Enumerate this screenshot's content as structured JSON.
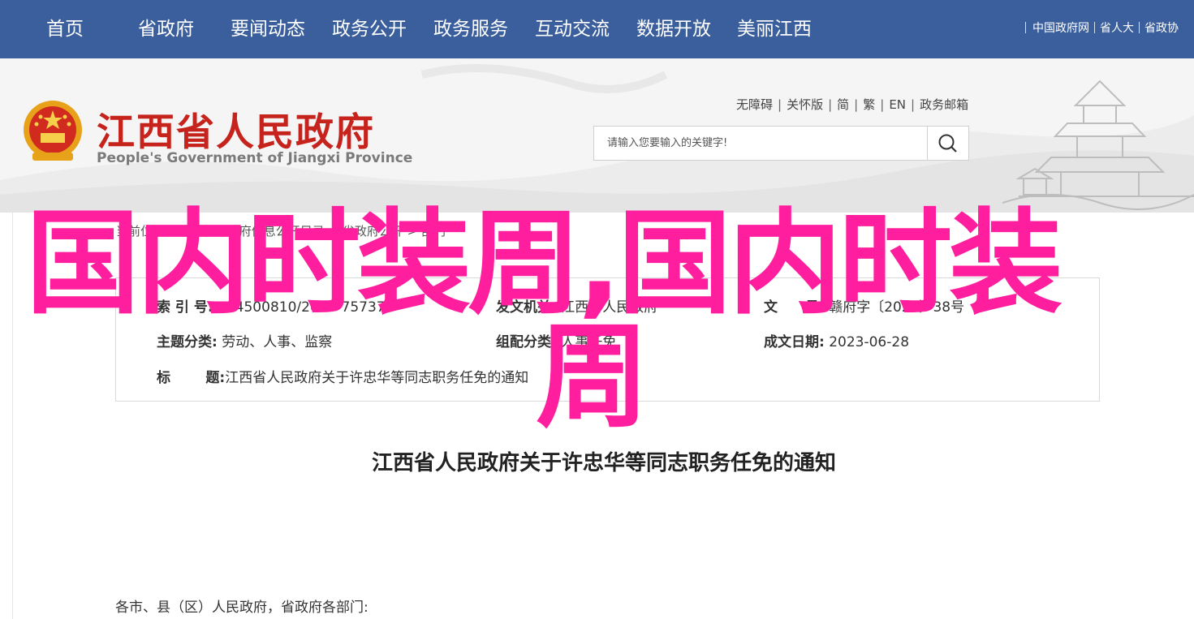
{
  "topnav": {
    "items": [
      "首页",
      "省政府",
      "要闻动态",
      "政务公开",
      "政务服务",
      "互动交流",
      "数据开放",
      "美丽江西"
    ],
    "links": [
      "中国政府网",
      "省人大",
      "省政协"
    ]
  },
  "header": {
    "title": "江西省人民政府",
    "subtitle": "People's Government of Jiangxi Province",
    "access_links": [
      "无障碍",
      "关怀版",
      "简",
      "繁",
      "EN",
      "政务邮箱"
    ],
    "search_placeholder": "请输入您要输入的关键字!"
  },
  "breadcrumb": [
    "当前位置",
    "首页",
    "政府信息公开目录",
    "省政府公开",
    "部门"
  ],
  "meta": {
    "index_label": "索 引 号:",
    "index_value": "014500810/2023-75737",
    "issuer_label": "发文机关:",
    "issuer_value": "江西省人民政府",
    "docno_label": "文　　号:",
    "docno_value": "赣府字〔2023〕38号",
    "category_label": "主题分类:",
    "category_value": "劳动、人事、监察",
    "genre_label": "组配分类:",
    "genre_value": "人事任免",
    "date_label": "成文日期:",
    "date_value": "2023-06-28",
    "title_label1": "标",
    "title_label2": "题:",
    "title_value": "江西省人民政府关于许忠华等同志职务任免的通知"
  },
  "document": {
    "title": "江西省人民政府关于许忠华等同志职务任免的通知",
    "salutation": "各市、县（区）人民政府，省政府各部门:"
  },
  "overlay": {
    "line1": "国内时装周,国内时装",
    "line2": "周"
  },
  "colors": {
    "nav_bg": "#3a5f9c",
    "title_red": "#c6231c",
    "overlay_pink": "#ff1f9e"
  },
  "icons": {
    "search": "search-icon",
    "emblem": "national-emblem-icon"
  }
}
